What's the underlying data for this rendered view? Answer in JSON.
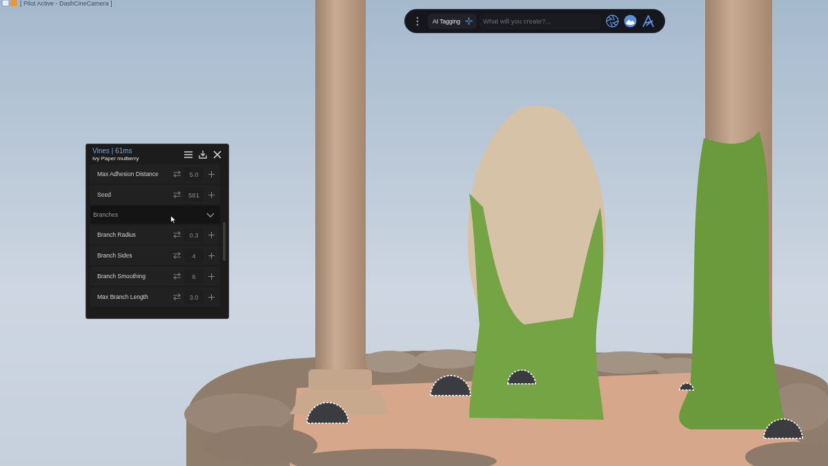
{
  "title_bar": {
    "text": "[ Pilot Active - DashCineCamera ]"
  },
  "prompt_bar": {
    "tag": "AI Tagging",
    "placeholder": "What will you create?..."
  },
  "vines_panel": {
    "title": "Vines | 61ms",
    "subtitle": "Ivy Paper mulberry",
    "properties": [
      {
        "label": "Max Adhesion Distance",
        "value": "5.0"
      },
      {
        "label": "Seed",
        "value": "581"
      }
    ],
    "sections": [
      {
        "title": "Branches",
        "expanded": true,
        "properties": [
          {
            "label": "Branch Radius",
            "value": "0.3"
          },
          {
            "label": "Branch Sides",
            "value": "4"
          },
          {
            "label": "Branch Smoothing",
            "value": "6"
          },
          {
            "label": "Max Branch Length",
            "value": "3.0"
          }
        ]
      }
    ]
  }
}
